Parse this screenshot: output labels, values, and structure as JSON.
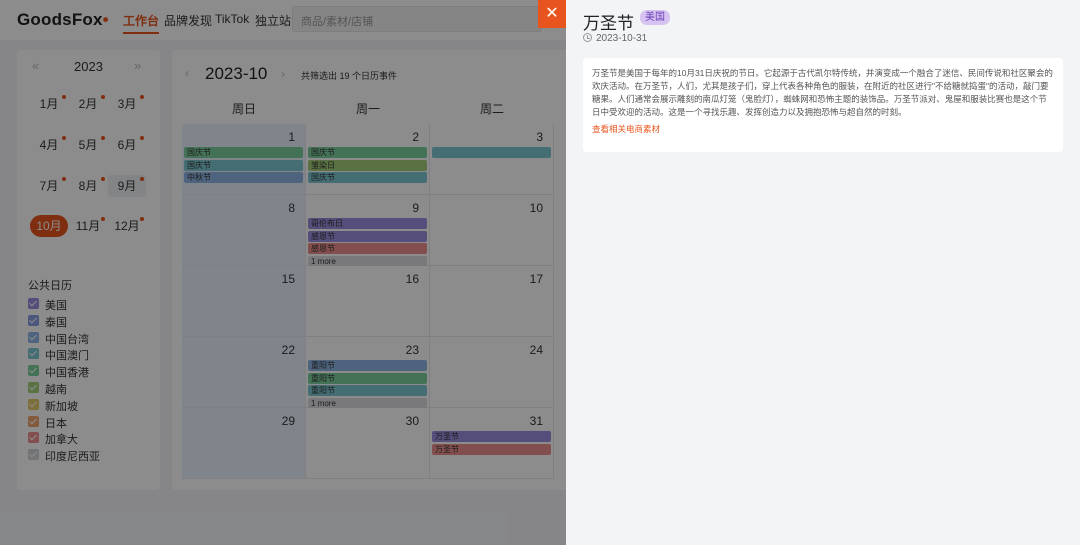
{
  "app": {
    "logo": "GoodsFox",
    "nav": [
      "工作台",
      "品牌发现",
      "TikTok",
      "独立站"
    ],
    "search_placeholder": "商品/素材/店铺"
  },
  "sidebar": {
    "year": "2023",
    "months": [
      "1月",
      "2月",
      "3月",
      "4月",
      "5月",
      "6月",
      "7月",
      "8月",
      "9月",
      "10月",
      "11月",
      "12月"
    ],
    "selected_month": "10月",
    "public_calendar_title": "公共日历",
    "regions": [
      {
        "label": "美国",
        "color": "#9c8ee0"
      },
      {
        "label": "泰国",
        "color": "#8b9ee3"
      },
      {
        "label": "中国台湾",
        "color": "#8fb6e6"
      },
      {
        "label": "中国澳门",
        "color": "#7cc9d1"
      },
      {
        "label": "中国香港",
        "color": "#7dcf9f"
      },
      {
        "label": "越南",
        "color": "#a4cf7a"
      },
      {
        "label": "新加坡",
        "color": "#e6c96a"
      },
      {
        "label": "日本",
        "color": "#f0a56d"
      },
      {
        "label": "加拿大",
        "color": "#ee8f8f"
      },
      {
        "label": "印度尼西亚",
        "color": "#d0d3d8"
      }
    ]
  },
  "calendar": {
    "title": "2023-10",
    "filter_text": "共筛选出 19 个日历事件",
    "weekdays": [
      "周日",
      "周一",
      "周二"
    ],
    "weeks": [
      [
        {
          "day": "1",
          "shaded": true,
          "events": [
            {
              "label": "国庆节",
              "color": "#7dcf9f"
            },
            {
              "label": "国庆节",
              "color": "#7cc9d1"
            },
            {
              "label": "中秋节",
              "color": "#8fb6e6"
            }
          ]
        },
        {
          "day": "2",
          "events": [
            {
              "label": "国庆节",
              "color": "#7dcf9f"
            },
            {
              "label": "雏染日",
              "color": "#a4cf7a"
            },
            {
              "label": "国庆节",
              "color": "#7cc9d1"
            }
          ]
        },
        {
          "day": "3",
          "events": [
            {
              "label": "",
              "color": "#7cc9d1"
            }
          ]
        }
      ],
      [
        {
          "day": "8",
          "shaded": true,
          "events": []
        },
        {
          "day": "9",
          "events": [
            {
              "label": "哥伦布日",
              "color": "#9c8ee0"
            },
            {
              "label": "感恩节",
              "color": "#9c8ee0"
            },
            {
              "label": "感恩节",
              "color": "#ee8f8f"
            },
            {
              "label": "1 more",
              "color": "#dcdde1"
            }
          ]
        },
        {
          "day": "10",
          "events": []
        }
      ],
      [
        {
          "day": "15",
          "shaded": true,
          "events": []
        },
        {
          "day": "16",
          "events": []
        },
        {
          "day": "17",
          "events": []
        }
      ],
      [
        {
          "day": "22",
          "shaded": true,
          "events": []
        },
        {
          "day": "23",
          "events": [
            {
              "label": "重阳节",
              "color": "#8fb6e6"
            },
            {
              "label": "重阳节",
              "color": "#7dcf9f"
            },
            {
              "label": "重阳节",
              "color": "#7cc9d1"
            },
            {
              "label": "1 more",
              "color": "#dcdde1"
            }
          ]
        },
        {
          "day": "24",
          "events": []
        }
      ],
      [
        {
          "day": "29",
          "shaded": true,
          "events": []
        },
        {
          "day": "30",
          "events": []
        },
        {
          "day": "31",
          "events": [
            {
              "label": "万圣节",
              "color": "#9c8ee0"
            },
            {
              "label": "万圣节",
              "color": "#ee8f8f"
            }
          ]
        }
      ]
    ]
  },
  "drawer": {
    "title": "万圣节",
    "badge": "美国",
    "date": "2023-10-31",
    "description": "万圣节是美国于每年的10月31日庆祝的节日。它起源于古代凯尔特传统，并演变成一个融合了迷信、民间传说和社区聚会的欢庆活动。在万圣节，人们，尤其是孩子们，穿上代表各种角色的服装，在附近的社区进行\"不给糖就捣蛋\"的活动，敲门要糖果。人们通常会展示雕刻的南瓜灯笼（鬼脸灯），蜘蛛网和恐怖主题的装饰品。万圣节派对、鬼屋和服装比赛也是这个节日中受欢迎的活动。这是一个寻找乐趣、发挥创造力以及拥抱恐怖与超自然的时刻。",
    "link": "查看相关电商素材",
    "close_symbol": "✕"
  },
  "colors": {
    "accent": "#e8541e",
    "badge_bg": "#d7c3f1",
    "badge_text": "#6a3fb5"
  }
}
